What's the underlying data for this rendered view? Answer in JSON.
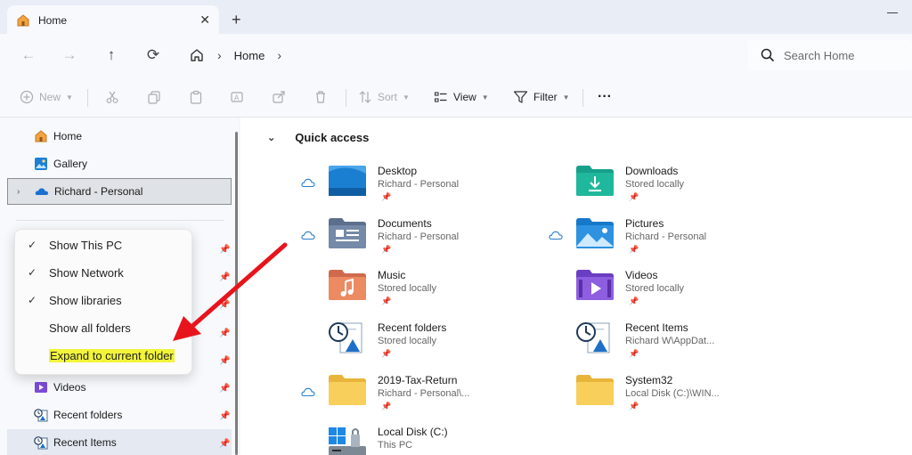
{
  "window": {
    "tab_title": "Home",
    "tab_close": "✕",
    "new_tab": "+"
  },
  "address": {
    "crumb_home": "Home",
    "sep1": "›",
    "sep2": "›",
    "search_placeholder": "Search Home"
  },
  "toolbar": {
    "new_label": "New",
    "sort_label": "Sort",
    "view_label": "View",
    "filter_label": "Filter",
    "more_label": "···"
  },
  "sidebar": {
    "items": [
      {
        "label": "Home",
        "icon": "home-icon"
      },
      {
        "label": "Gallery",
        "icon": "gallery-icon"
      },
      {
        "label": "Richard - Personal",
        "icon": "onedrive-icon"
      },
      {
        "label": "Videos",
        "icon": "videos-icon"
      },
      {
        "label": "Recent folders",
        "icon": "recent-folders-icon"
      },
      {
        "label": "Recent Items",
        "icon": "recent-items-icon"
      }
    ],
    "expand_glyph": "›",
    "pin_glyph": "📌"
  },
  "context_menu": {
    "items": [
      {
        "label": "Show This PC",
        "checked": true
      },
      {
        "label": "Show Network",
        "checked": true
      },
      {
        "label": "Show libraries",
        "checked": true
      },
      {
        "label": "Show all folders",
        "checked": false
      },
      {
        "label": "Expand to current folder",
        "checked": false,
        "highlighted": true
      }
    ],
    "check_glyph": "✓"
  },
  "quick_access": {
    "header": "Quick access",
    "chevron": "⌄",
    "items": [
      {
        "name": "Desktop",
        "sub": "Richard - Personal",
        "cloud": true,
        "icon": "desktop-folder-icon"
      },
      {
        "name": "Downloads",
        "sub": "Stored locally",
        "cloud": false,
        "icon": "downloads-folder-icon"
      },
      {
        "name": "Documents",
        "sub": "Richard - Personal",
        "cloud": true,
        "icon": "documents-folder-icon"
      },
      {
        "name": "Pictures",
        "sub": "Richard - Personal",
        "cloud": true,
        "icon": "pictures-folder-icon"
      },
      {
        "name": "Music",
        "sub": "Stored locally",
        "cloud": false,
        "icon": "music-folder-icon"
      },
      {
        "name": "Videos",
        "sub": "Stored locally",
        "cloud": false,
        "icon": "videos-folder-icon"
      },
      {
        "name": "Recent folders",
        "sub": "Stored locally",
        "cloud": false,
        "icon": "recent-folders-icon"
      },
      {
        "name": "Recent Items",
        "sub": "Richard W\\AppDat...",
        "cloud": false,
        "icon": "recent-items-icon"
      },
      {
        "name": "2019-Tax-Return",
        "sub": "Richard - Personal\\...",
        "cloud": true,
        "icon": "folder-icon"
      },
      {
        "name": "System32",
        "sub": "Local Disk (C:)\\WIN...",
        "cloud": false,
        "icon": "folder-icon"
      },
      {
        "name": "Local Disk (C:)",
        "sub": "This PC",
        "cloud": false,
        "icon": "local-disk-icon"
      }
    ]
  },
  "colors": {
    "accent": "#0067c0",
    "arrow": "#e8141b",
    "highlight": "#f2f43a"
  }
}
